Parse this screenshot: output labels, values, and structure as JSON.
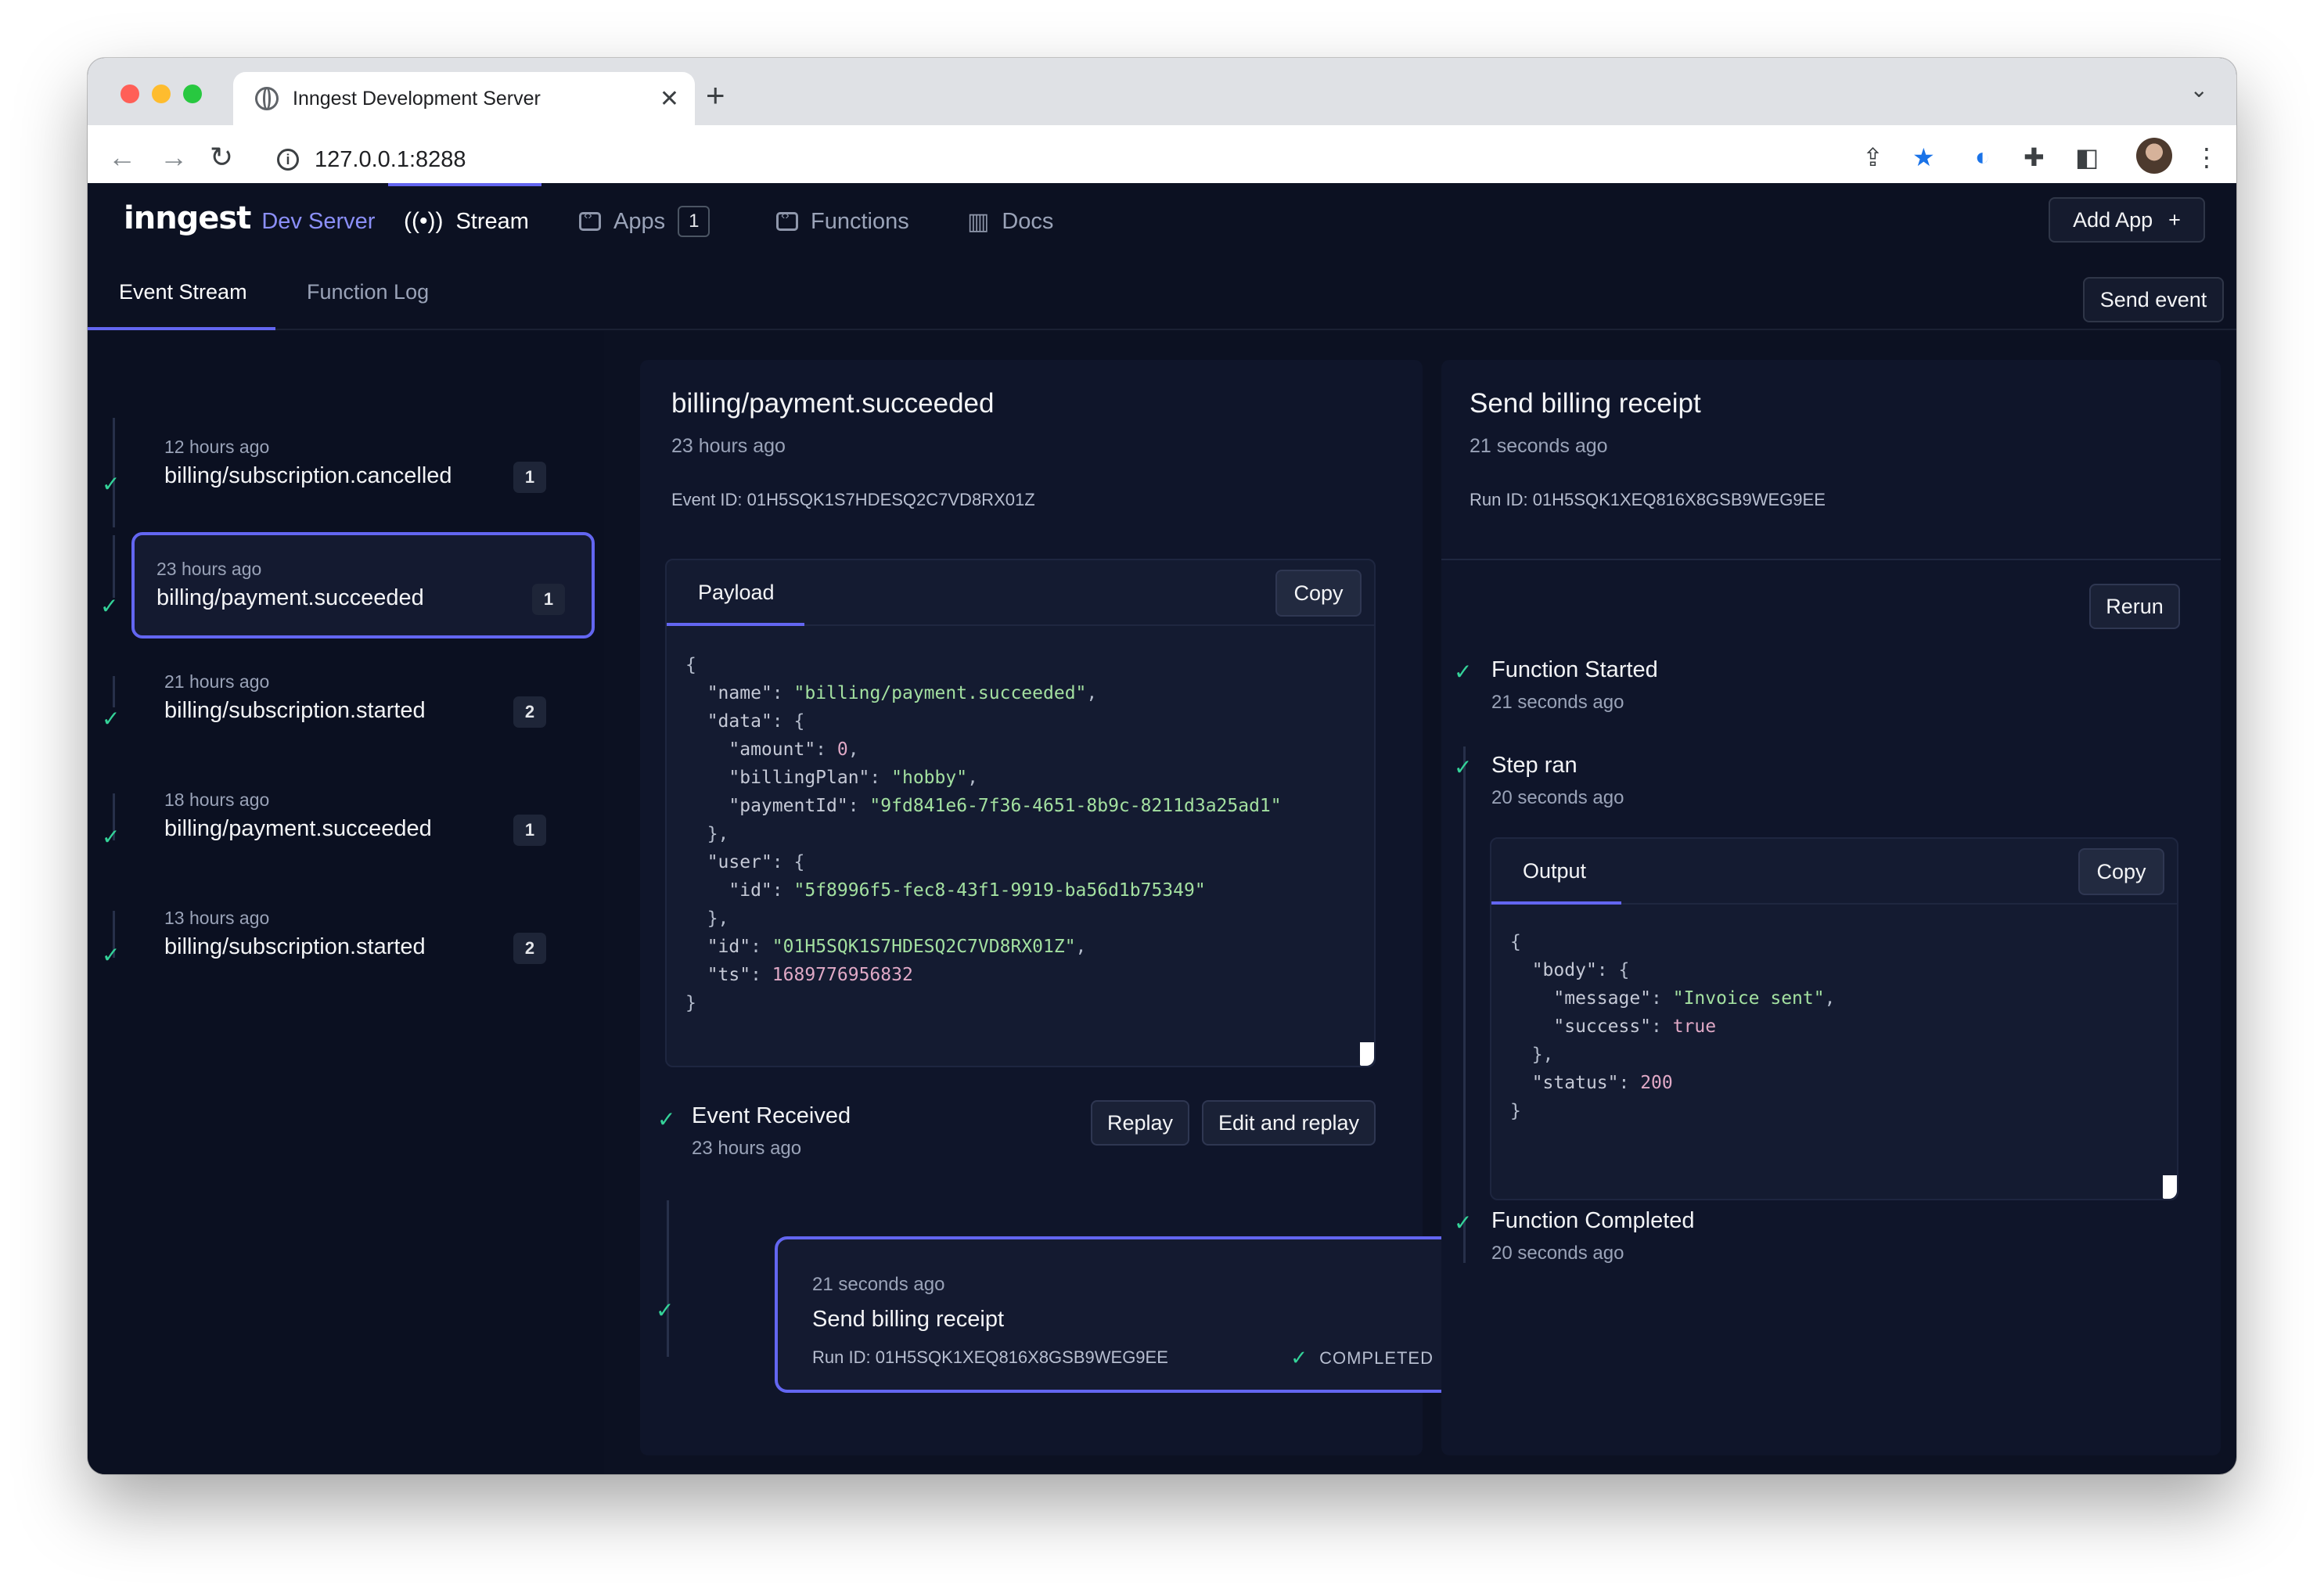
{
  "browser": {
    "tab_title": "Inngest Development Server",
    "tab_close": "✕",
    "new_tab": "+",
    "url": "127.0.0.1:8288"
  },
  "app": {
    "logo": "inngest",
    "logo_sub": "Dev Server",
    "nav": {
      "stream": "Stream",
      "apps": "Apps",
      "apps_count": "1",
      "functions": "Functions",
      "docs": "Docs"
    },
    "add_app": "Add App",
    "add_app_plus": "+"
  },
  "subnav": {
    "event_stream": "Event Stream",
    "function_log": "Function Log",
    "send_event": "Send event"
  },
  "events": [
    {
      "time": "12 hours ago",
      "name": "billing/subscription.cancelled",
      "count": "1"
    },
    {
      "time": "23 hours ago",
      "name": "billing/payment.succeeded",
      "count": "1"
    },
    {
      "time": "21 hours ago",
      "name": "billing/subscription.started",
      "count": "2"
    },
    {
      "time": "18 hours ago",
      "name": "billing/payment.succeeded",
      "count": "1"
    },
    {
      "time": "13 hours ago",
      "name": "billing/subscription.started",
      "count": "2"
    }
  ],
  "event_detail": {
    "title": "billing/payment.succeeded",
    "time": "23 hours ago",
    "event_id": "Event ID: 01H5SQK1S7HDESQ2C7VD8RX01Z",
    "payload_tab": "Payload",
    "copy": "Copy",
    "payload": {
      "name": "billing/payment.succeeded",
      "amount": "0",
      "billingPlan": "hobby",
      "paymentId": "9fd841e6-7f36-4651-8b9c-8211d3a25ad1",
      "user_id": "5f8996f5-fec8-43f1-9919-ba56d1b75349",
      "id": "01H5SQK1S7HDESQ2C7VD8RX01Z",
      "ts": "1689776956832"
    },
    "received_title": "Event Received",
    "received_time": "23 hours ago",
    "replay": "Replay",
    "edit_replay": "Edit and replay",
    "run": {
      "time": "21 seconds ago",
      "name": "Send billing receipt",
      "run_id": "Run ID: 01H5SQK1XEQ816X8GSB9WEG9EE",
      "status": "COMPLETED"
    }
  },
  "run_detail": {
    "title": "Send billing receipt",
    "time": "21 seconds ago",
    "run_id": "Run ID: 01H5SQK1XEQ816X8GSB9WEG9EE",
    "rerun": "Rerun",
    "steps": [
      {
        "title": "Function Started",
        "time": "21 seconds ago"
      },
      {
        "title": "Step ran",
        "time": "20 seconds ago"
      },
      {
        "title": "Function Completed",
        "time": "20 seconds ago"
      }
    ],
    "output_tab": "Output",
    "copy": "Copy",
    "output": {
      "message": "Invoice sent",
      "success": "true",
      "status": "200"
    }
  },
  "colors": {
    "accent": "#6366f1",
    "success": "#34d399",
    "background": "#0c1122"
  }
}
